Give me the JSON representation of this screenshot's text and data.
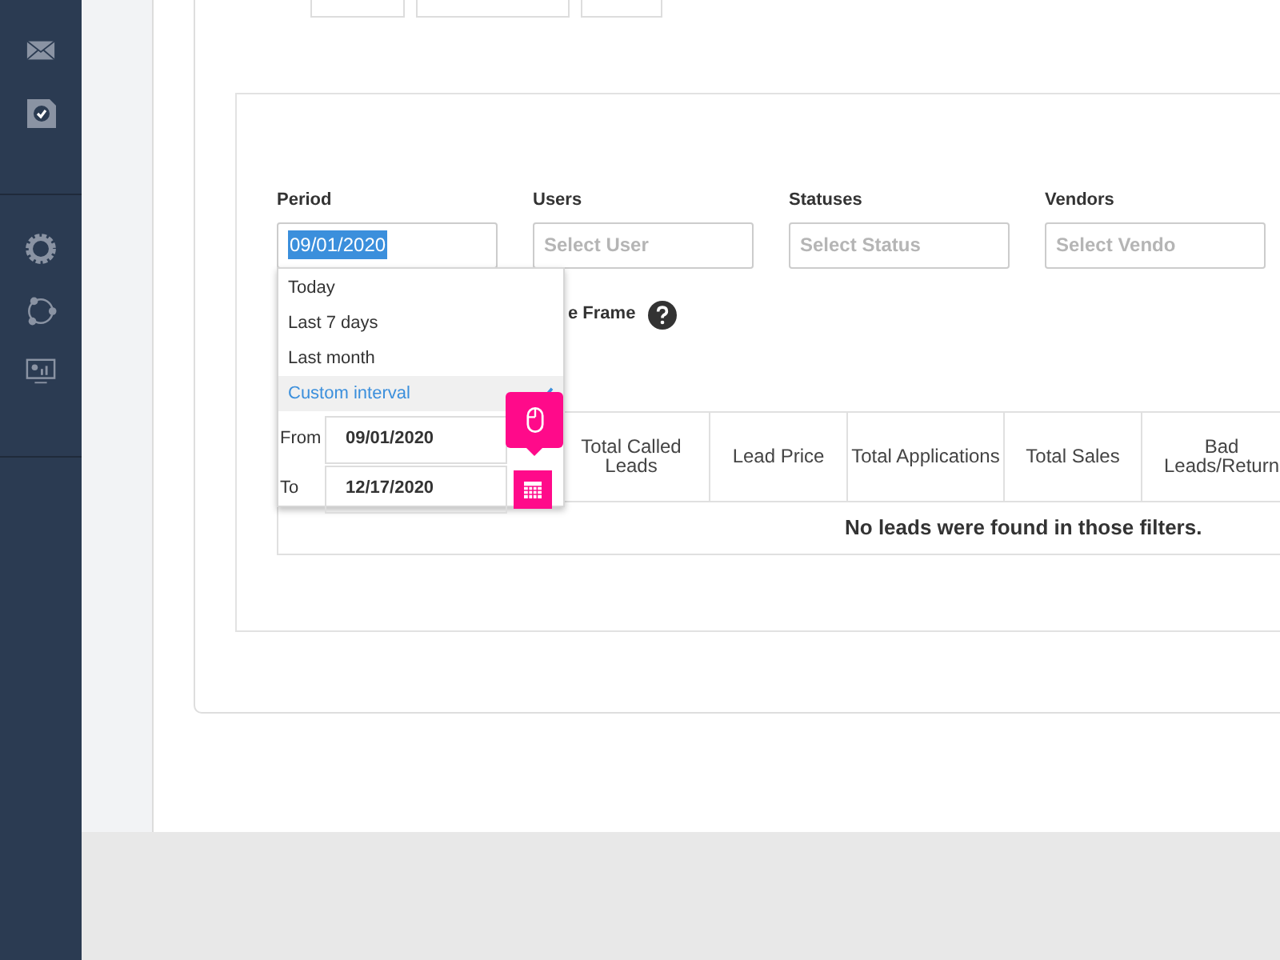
{
  "filters": [
    {
      "label": "Period",
      "value": "09/01/2020",
      "value_selected": true
    },
    {
      "label": "Users",
      "placeholder": "Select User"
    },
    {
      "label": "Statuses",
      "placeholder": "Select Status"
    },
    {
      "label": "Vendors",
      "placeholder": "Select Vendo"
    }
  ],
  "time_frame_label": "e Frame",
  "period_menu": {
    "options": [
      {
        "label": "Today",
        "selected": false
      },
      {
        "label": "Last 7 days",
        "selected": false
      },
      {
        "label": "Last month",
        "selected": false
      },
      {
        "label": "Custom interval",
        "selected": true
      }
    ],
    "from_label": "From",
    "from_value": "09/01/2020",
    "to_label": "To",
    "to_value": "12/17/2020"
  },
  "table": {
    "columns": [
      "Total Called Leads",
      "Lead Price",
      "Total Applications",
      "Total Sales",
      "Bad Leads/Return"
    ],
    "empty_message": "No leads were found in those filters."
  }
}
